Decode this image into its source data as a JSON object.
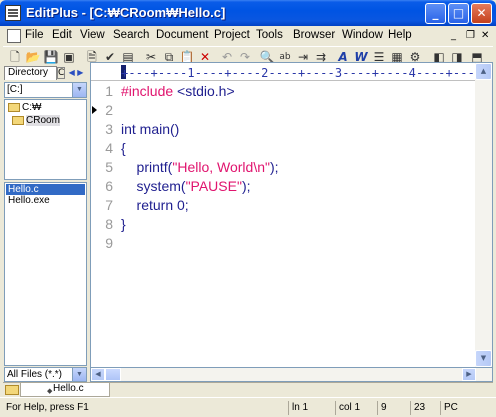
{
  "window": {
    "title": "EditPlus - [C:₩CRoom₩Hello.c]",
    "controls": {
      "minimize": "_",
      "maximize": "□",
      "close": "✕"
    }
  },
  "menu": {
    "items": [
      "File",
      "Edit",
      "View",
      "Search",
      "Document",
      "Project",
      "Tools",
      "Browser",
      "Window",
      "Help"
    ],
    "mdi_controls": {
      "minimize": "_",
      "restore": "❐",
      "close": "✕"
    }
  },
  "toolbar": {
    "buttons": [
      "new-file",
      "open-folder",
      "save",
      "save-all",
      "print-preview",
      "spell-check",
      "properties",
      "cut",
      "copy",
      "paste",
      "delete",
      "undo",
      "redo",
      "find",
      "replace",
      "goto",
      "indent",
      "italic-a",
      "word-wrap",
      "hex-view",
      "ruler",
      "settings",
      "toggle-directory",
      "split-window",
      "toggle-output"
    ]
  },
  "left_panel": {
    "tabs": {
      "directory": "Directory",
      "other": "C"
    },
    "drive": "[C:]",
    "tree": [
      {
        "label": "C:₩",
        "selected": false
      },
      {
        "label": "CRoom",
        "selected": true
      }
    ],
    "files": [
      {
        "name": "Hello.c",
        "selected": true
      },
      {
        "name": "Hello.exe",
        "selected": false
      }
    ],
    "filter": "All Files (*.*)"
  },
  "editor": {
    "ruler": "+---+----1----+----2----+----3----+----4----+----5",
    "line_numbers": [
      "1",
      "2",
      "3",
      "4",
      "5",
      "6",
      "7",
      "8",
      "9"
    ],
    "lines": [
      [
        {
          "t": "#include",
          "c": "pre"
        },
        {
          "t": " <stdio.h>",
          "c": "kw"
        }
      ],
      [],
      [
        {
          "t": "int main()",
          "c": "kw"
        }
      ],
      [
        {
          "t": "{",
          "c": "kw"
        }
      ],
      [
        {
          "t": "    printf(",
          "c": "kw"
        },
        {
          "t": "\"Hello, World\\n\"",
          "c": "str"
        },
        {
          "t": ");",
          "c": "kw"
        }
      ],
      [
        {
          "t": "    system(",
          "c": "kw"
        },
        {
          "t": "\"PAUSE\"",
          "c": "str"
        },
        {
          "t": ");",
          "c": "kw"
        }
      ],
      [
        {
          "t": "    return 0;",
          "c": "kw"
        }
      ],
      [
        {
          "t": "}",
          "c": "kw"
        }
      ],
      []
    ]
  },
  "doc_tabs": [
    {
      "label": "Hello.c",
      "active": true
    }
  ],
  "status": {
    "help": "For Help, press F1",
    "line": "ln 1",
    "col": "col 1",
    "chars": "9",
    "total_lines": "23",
    "format": "PC"
  }
}
